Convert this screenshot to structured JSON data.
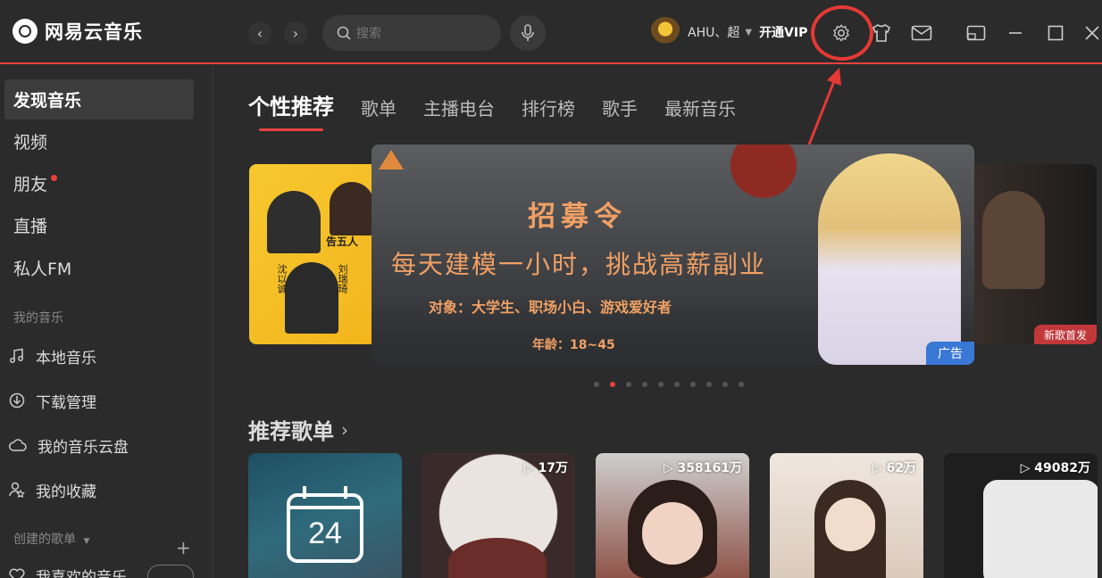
{
  "app": {
    "name": "网易云音乐"
  },
  "search": {
    "placeholder": "搜索"
  },
  "user": {
    "name": "AHU、超",
    "vip_label": "开通VIP"
  },
  "sidebar": {
    "items": [
      {
        "label": "发现音乐"
      },
      {
        "label": "视频"
      },
      {
        "label": "朋友"
      },
      {
        "label": "直播"
      },
      {
        "label": "私人FM"
      }
    ],
    "my_music_title": "我的音乐",
    "my_music": [
      {
        "label": "本地音乐",
        "icon": "music-note-icon"
      },
      {
        "label": "下载管理",
        "icon": "download-icon"
      },
      {
        "label": "我的音乐云盘",
        "icon": "cloud-icon"
      },
      {
        "label": "我的收藏",
        "icon": "collection-icon"
      }
    ],
    "created_title": "创建的歌单",
    "liked_label": "我喜欢的音乐"
  },
  "tabs": [
    "个性推荐",
    "歌单",
    "主播电台",
    "排行榜",
    "歌手",
    "最新音乐"
  ],
  "banner": {
    "title": "招募令",
    "subtitle": "每天建模一小时，挑战高薪副业",
    "target": "对象：大学生、职场小白、游戏爱好者",
    "age": "年龄：18~45",
    "ad_tag": "广告",
    "right_tag": "新歌首发",
    "left_text_1": "告五人",
    "left_text_2": "沈以诚",
    "left_text_3": "刘瑞琦"
  },
  "section": {
    "title": "推荐歌单"
  },
  "playlists": [
    {
      "count": "",
      "cover_text": "24"
    },
    {
      "count": "17万"
    },
    {
      "count": "358161万"
    },
    {
      "count": "62万"
    },
    {
      "count": "49082万"
    }
  ],
  "colors": {
    "accent": "#ec4141",
    "ad_blue": "#3a78d6",
    "banner_text": "#f1a064"
  }
}
